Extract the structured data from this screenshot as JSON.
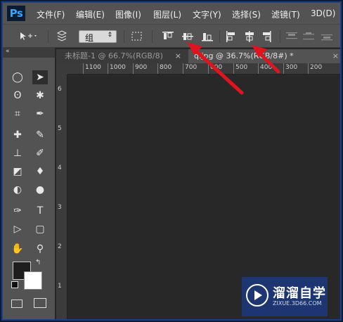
{
  "app": {
    "logo": "Ps"
  },
  "menu": [
    "文件(F)",
    "编辑(E)",
    "图像(I)",
    "图层(L)",
    "文字(Y)",
    "选择(S)",
    "滤镜(T)",
    "3D(D)"
  ],
  "options": {
    "auto_select_value": "组"
  },
  "tools_header": "«",
  "tabs": [
    {
      "label": "未标题-1 @ 66.7%(RGB/8)",
      "close": "×"
    },
    {
      "label": "q.jpg @ 36.7%(RGB/8#) *",
      "close": "×"
    }
  ],
  "ruler": {
    "horizontal": [
      "1100",
      "1000",
      "900",
      "800",
      "700",
      "600",
      "500",
      "400",
      "300",
      "200"
    ],
    "vertical": [
      "6",
      "5",
      "4",
      "3",
      "2",
      "1"
    ]
  },
  "watermark": {
    "title": "溜溜自学",
    "url": "ZIXUE.3D66.COM"
  },
  "colors": {
    "arrow": "#e0141e",
    "accent": "#31a8ff",
    "panel": "#535353"
  }
}
